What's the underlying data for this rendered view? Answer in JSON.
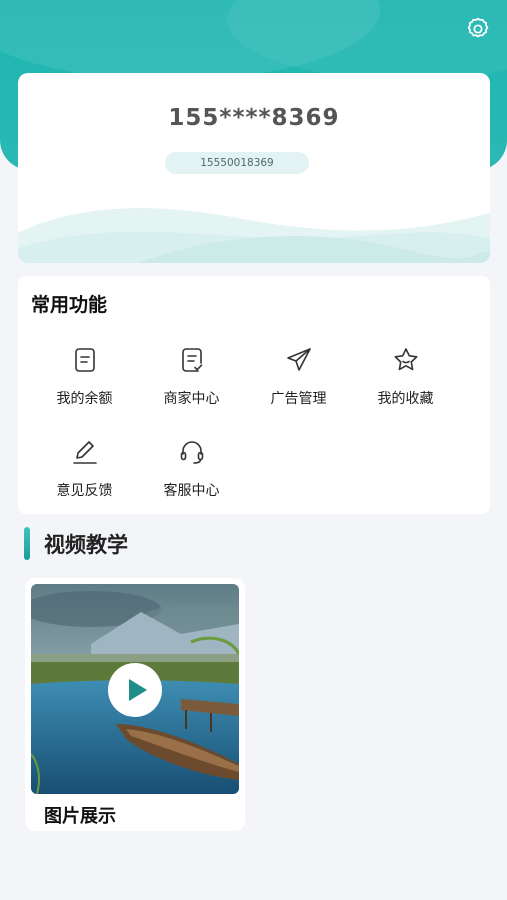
{
  "profile": {
    "masked_phone": "155****8369",
    "phone_number": "15550018369"
  },
  "functions": {
    "title": "常用功能",
    "items": [
      {
        "label": "我的余额",
        "icon": "document-icon"
      },
      {
        "label": "商家中心",
        "icon": "document-check-icon"
      },
      {
        "label": "广告管理",
        "icon": "send-plane-icon"
      },
      {
        "label": "我的收藏",
        "icon": "star-icon"
      },
      {
        "label": "意见反馈",
        "icon": "pencil-icon"
      },
      {
        "label": "客服中心",
        "icon": "headset-icon"
      }
    ]
  },
  "videos": {
    "section_title": "视频教学",
    "items": [
      {
        "title": "图片展示"
      }
    ]
  },
  "colors": {
    "accent": "#1fb5b0",
    "background": "#f4f5f9"
  }
}
